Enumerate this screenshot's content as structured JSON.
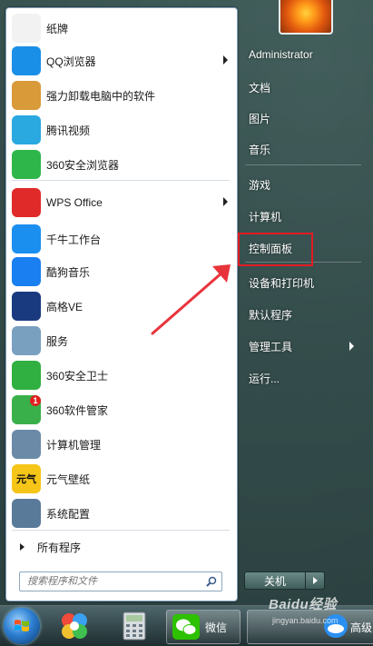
{
  "start_menu": {
    "left_items": [
      {
        "label": "纸牌",
        "icon": "solitaire-icon",
        "color": "#f2f2f2"
      },
      {
        "label": "QQ浏览器",
        "icon": "qq-browser-icon",
        "color": "#1a8fe8",
        "has_submenu": true
      },
      {
        "label": "强力卸载电脑中的软件",
        "icon": "uninstall-box-icon",
        "color": "#d99a3a"
      },
      {
        "label": "腾讯视频",
        "icon": "tencent-video-icon",
        "color": "#2aa8e0"
      },
      {
        "label": "360安全浏览器",
        "icon": "360-browser-icon",
        "color": "#2fb64a"
      },
      {
        "label": "WPS Office",
        "icon": "wps-office-icon",
        "color": "#e02a2a",
        "has_submenu": true
      },
      {
        "label": "千牛工作台",
        "icon": "qianniu-icon",
        "color": "#1a8ff0"
      },
      {
        "label": "酷狗音乐",
        "icon": "kugou-music-icon",
        "color": "#1a7ff0"
      },
      {
        "label": "高格VE",
        "icon": "gaoge-ve-icon",
        "color": "#1a3a80"
      },
      {
        "label": "服务",
        "icon": "services-gear-icon",
        "color": "#7aa0c0"
      },
      {
        "label": "360安全卫士",
        "icon": "360-safe-icon",
        "color": "#30b040"
      },
      {
        "label": "360软件管家",
        "icon": "360-software-manager-icon",
        "color": "#3ab04a",
        "badge": "1"
      },
      {
        "label": "计算机管理",
        "icon": "computer-management-icon",
        "color": "#6a8aa8"
      },
      {
        "label": "元气壁纸",
        "icon": "yuanqi-wallpaper-icon",
        "color": "#f5c518",
        "glyph": "元气"
      },
      {
        "label": "系统配置",
        "icon": "system-config-icon",
        "color": "#5a7a9a"
      }
    ],
    "all_programs": "所有程序",
    "search_placeholder": "搜索程序和文件",
    "right_items": [
      {
        "label": "Administrator"
      },
      {
        "label": "文档"
      },
      {
        "label": "图片"
      },
      {
        "label": "音乐"
      },
      {
        "label": "游戏"
      },
      {
        "label": "计算机"
      },
      {
        "label": "控制面板",
        "highlighted": true
      },
      {
        "label": "设备和打印机"
      },
      {
        "label": "默认程序"
      },
      {
        "label": "管理工具",
        "has_submenu": true
      },
      {
        "label": "运行..."
      }
    ],
    "shutdown_label": "关机"
  },
  "taskbar": {
    "wechat_label": "微信",
    "right_label": "高级"
  },
  "watermark": {
    "line1": "Baidu经验",
    "line2": "jingyan.baidu.com"
  },
  "colors": {
    "highlight_box": "#e31b23",
    "annotation_arrow": "#e8333b"
  }
}
